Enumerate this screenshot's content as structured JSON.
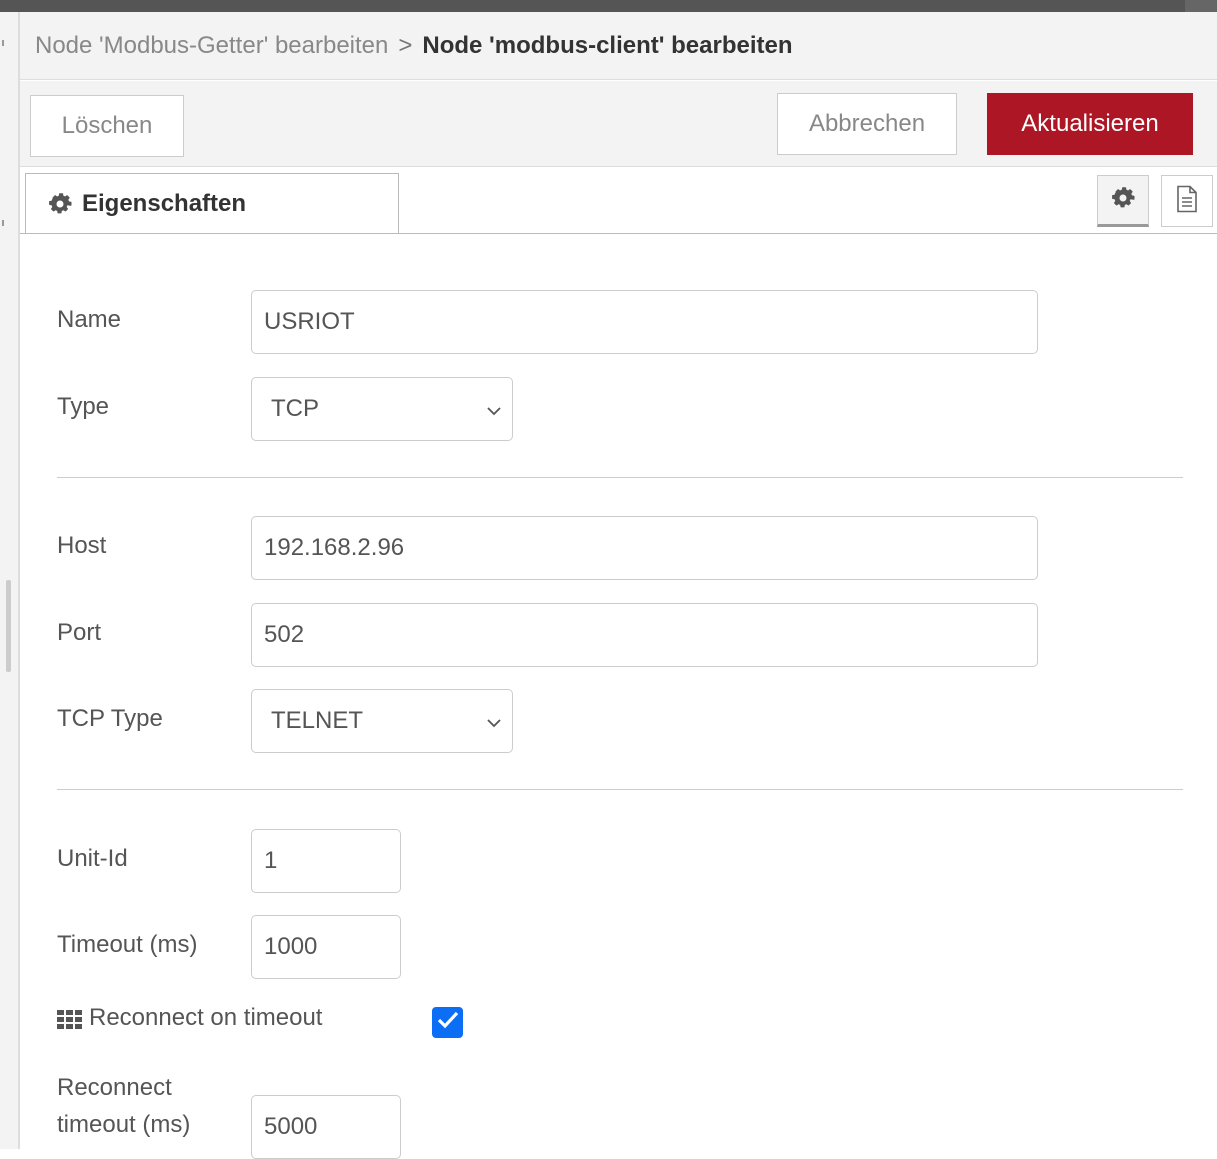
{
  "breadcrumb": {
    "previous": "Node 'Modbus-Getter' bearbeiten",
    "separator": ">",
    "current": "Node 'modbus-client' bearbeiten"
  },
  "toolbar": {
    "delete_label": "Löschen",
    "cancel_label": "Abbrechen",
    "update_label": "Aktualisieren"
  },
  "tabs": {
    "properties_label": "Eigenschaften",
    "settings_icon": "gear-icon",
    "description_icon": "document-icon"
  },
  "form": {
    "name_label": "Name",
    "name_value": "USRIOT",
    "type_label": "Type",
    "type_value": "TCP",
    "host_label": "Host",
    "host_value": "192.168.2.96",
    "port_label": "Port",
    "port_value": "502",
    "tcp_type_label": "TCP Type",
    "tcp_type_value": "TELNET",
    "unit_id_label": "Unit-Id",
    "unit_id_value": "1",
    "timeout_label": "Timeout (ms)",
    "timeout_value": "1000",
    "reconnect_on_timeout_label": "Reconnect on timeout",
    "reconnect_on_timeout_checked": true,
    "reconnect_timeout_label_line1": "Reconnect",
    "reconnect_timeout_label_line2": "timeout (ms)",
    "reconnect_timeout_value": "5000"
  },
  "colors": {
    "primary_button": "#ad1625",
    "checkbox": "#0b6ef5",
    "header_bg": "#f3f3f3"
  }
}
